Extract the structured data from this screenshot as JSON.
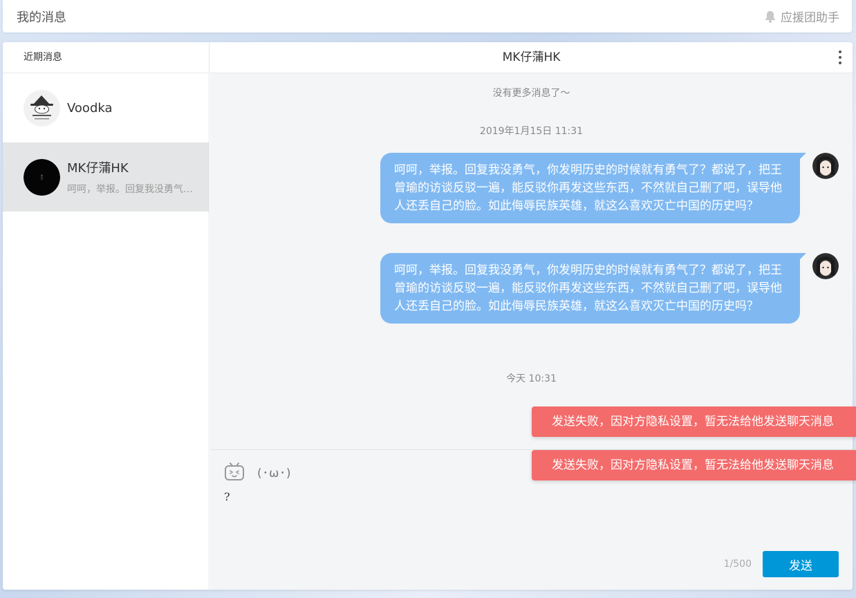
{
  "header": {
    "title": "我的消息",
    "helper_label": "应援团助手"
  },
  "sidebar": {
    "heading": "近期消息",
    "contacts": [
      {
        "name": "Voodka",
        "preview": ""
      },
      {
        "name": "MK仔蒲HK",
        "preview": "呵呵，举报。回复我没勇气，你发明历史的时候就有勇气了？都说了，把王曾瑜的访谈反驳一遍"
      }
    ]
  },
  "chat": {
    "title": "MK仔蒲HK",
    "no_more": "没有更多消息了～",
    "timestamp_1": "2019年1月15日 11:31",
    "messages": [
      {
        "text": "呵呵，举报。回复我没勇气，你发明历史的时候就有勇气了？都说了，把王曾瑜的访谈反驳一遍，能反驳你再发这些东西，不然就自己删了吧，误导他人还丢自己的脸。如此侮辱民族英雄，就这么喜欢灭亡中国的历史吗？"
      },
      {
        "text": "呵呵，举报。回复我没勇气，你发明历史的时候就有勇气了？都说了，把王曾瑜的访谈反驳一遍，能反驳你再发这些东西，不然就自己删了吧，误导他人还丢自己的脸。如此侮辱民族英雄，就这么喜欢灭亡中国的历史吗？"
      }
    ],
    "timestamp_2": "今天 10:31"
  },
  "composer": {
    "kaomoji": "(･ω･)",
    "input_value": "?",
    "counter": "1/500",
    "send_label": "发送"
  },
  "toasts": [
    "发送失败，因对方隐私设置，暂无法给他发送聊天消息",
    "发送失败，因对方隐私设置，暂无法给他发送聊天消息"
  ],
  "colors": {
    "bubble": "#80b9f2",
    "send_button": "#0097d8",
    "toast": "#f46b6b"
  }
}
